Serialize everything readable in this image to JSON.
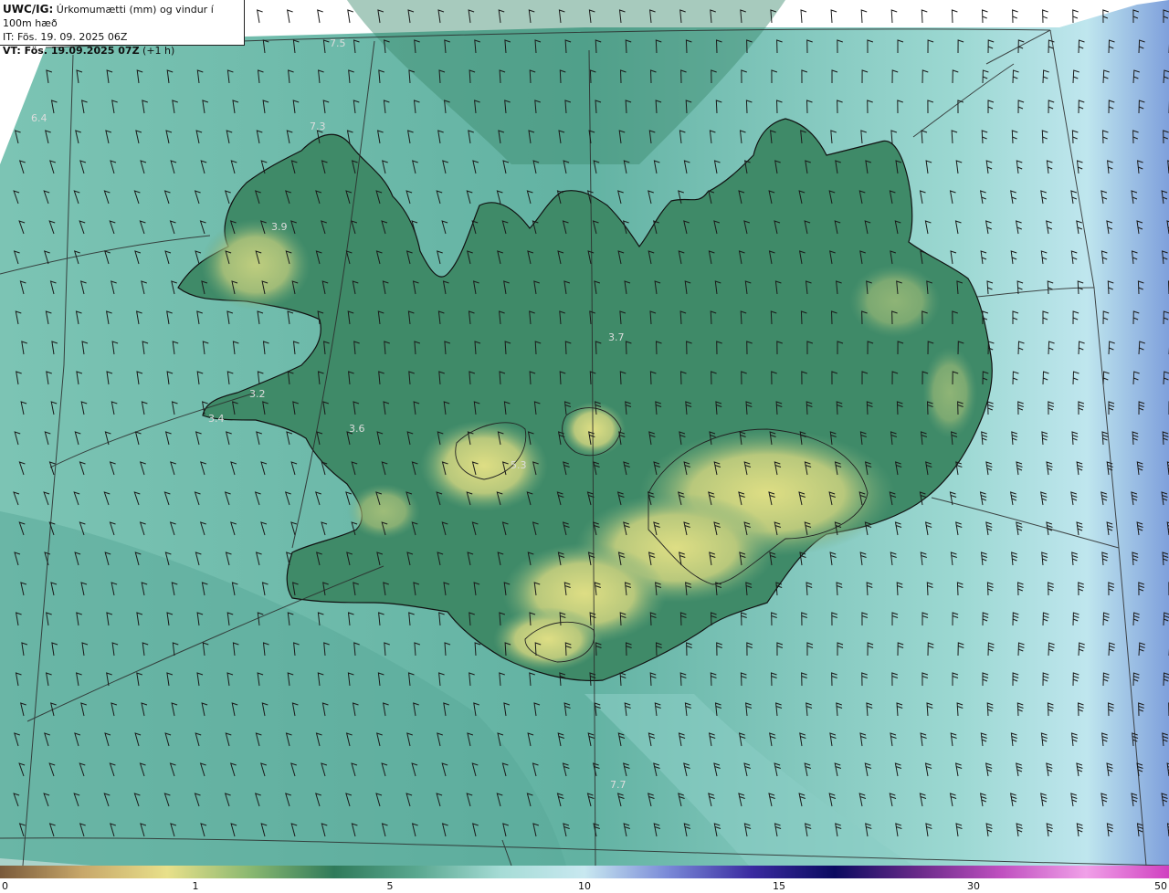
{
  "header": {
    "product": "UWC/IG:",
    "description": "Úrkomumætti (mm) og vindur í 100m hæð",
    "issue_line": "IT: Fös. 19. 09. 2025 06Z",
    "valid_prefix": "VT: ",
    "valid_time": "Fös. 19.09.2025 07Z",
    "valid_offset": " (+1 h)"
  },
  "map_labels": [
    {
      "text": "7.5"
    },
    {
      "text": "6.4"
    },
    {
      "text": "7.3"
    },
    {
      "text": "3.9"
    },
    {
      "text": "3.7"
    },
    {
      "text": "3.2"
    },
    {
      "text": "3.4"
    },
    {
      "text": "3.6"
    },
    {
      "text": "5.3"
    },
    {
      "text": "7.7"
    }
  ],
  "colorbar": {
    "ticks": [
      "0",
      "1",
      "5",
      "10",
      "15",
      "30",
      "50"
    ],
    "colors": [
      "#7a5a3a",
      "#c8a86a",
      "#e8e08a",
      "#8ab870",
      "#2f7a5a",
      "#5aa890",
      "#a6dcd6",
      "#c8e8f0",
      "#7a8ad8",
      "#3a2aa0",
      "#0a0a60",
      "#6a2a8a",
      "#c050c0",
      "#f0a0e8",
      "#d040c0"
    ]
  },
  "colors": {
    "sea": "#5fb0a4",
    "sea_light": "#a8dcd6",
    "land_dark": "#2e7a5c",
    "land_mid": "#5aa07a",
    "land_high": "#d4d47a",
    "coast": "#111111",
    "grid": "#333333"
  }
}
